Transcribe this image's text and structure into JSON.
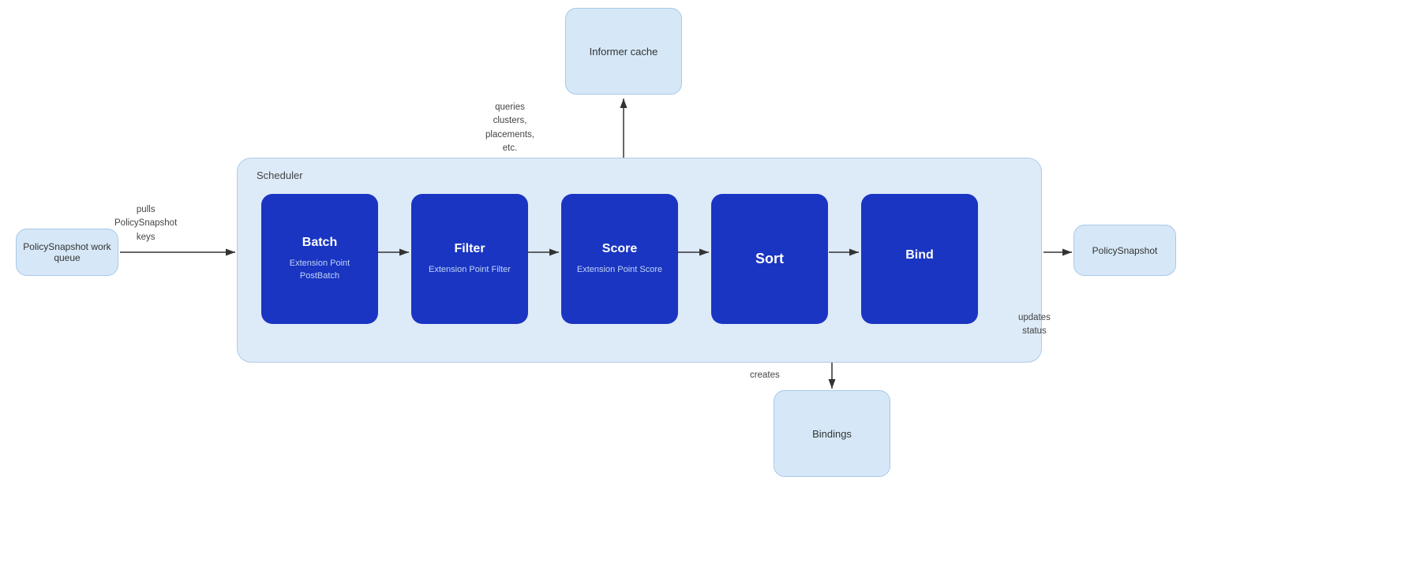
{
  "informer_cache": {
    "label": "Informer cache"
  },
  "work_queue": {
    "label": "PolicySnapshot work queue"
  },
  "policy_snapshot_out": {
    "label": "PolicySnapshot"
  },
  "bindings": {
    "label": "Bindings"
  },
  "scheduler": {
    "label": "Scheduler"
  },
  "steps": [
    {
      "title": "Batch",
      "sub": "Extension Point PostBatch"
    },
    {
      "title": "Filter",
      "sub": "Extension Point Filter"
    },
    {
      "title": "Score",
      "sub": "Extension Point Score"
    },
    {
      "title": "Sort",
      "sub": ""
    },
    {
      "title": "Bind",
      "sub": ""
    }
  ],
  "labels": {
    "pulls": "pulls\nPolicySnapshot\nkeys",
    "pulls_line1": "pulls",
    "pulls_line2": "PolicySnapshot",
    "pulls_line3": "keys",
    "queries_line1": "queries",
    "queries_line2": "clusters,",
    "queries_line3": "placements,",
    "queries_line4": "etc.",
    "creates": "creates",
    "updates_line1": "updates",
    "updates_line2": "status"
  }
}
